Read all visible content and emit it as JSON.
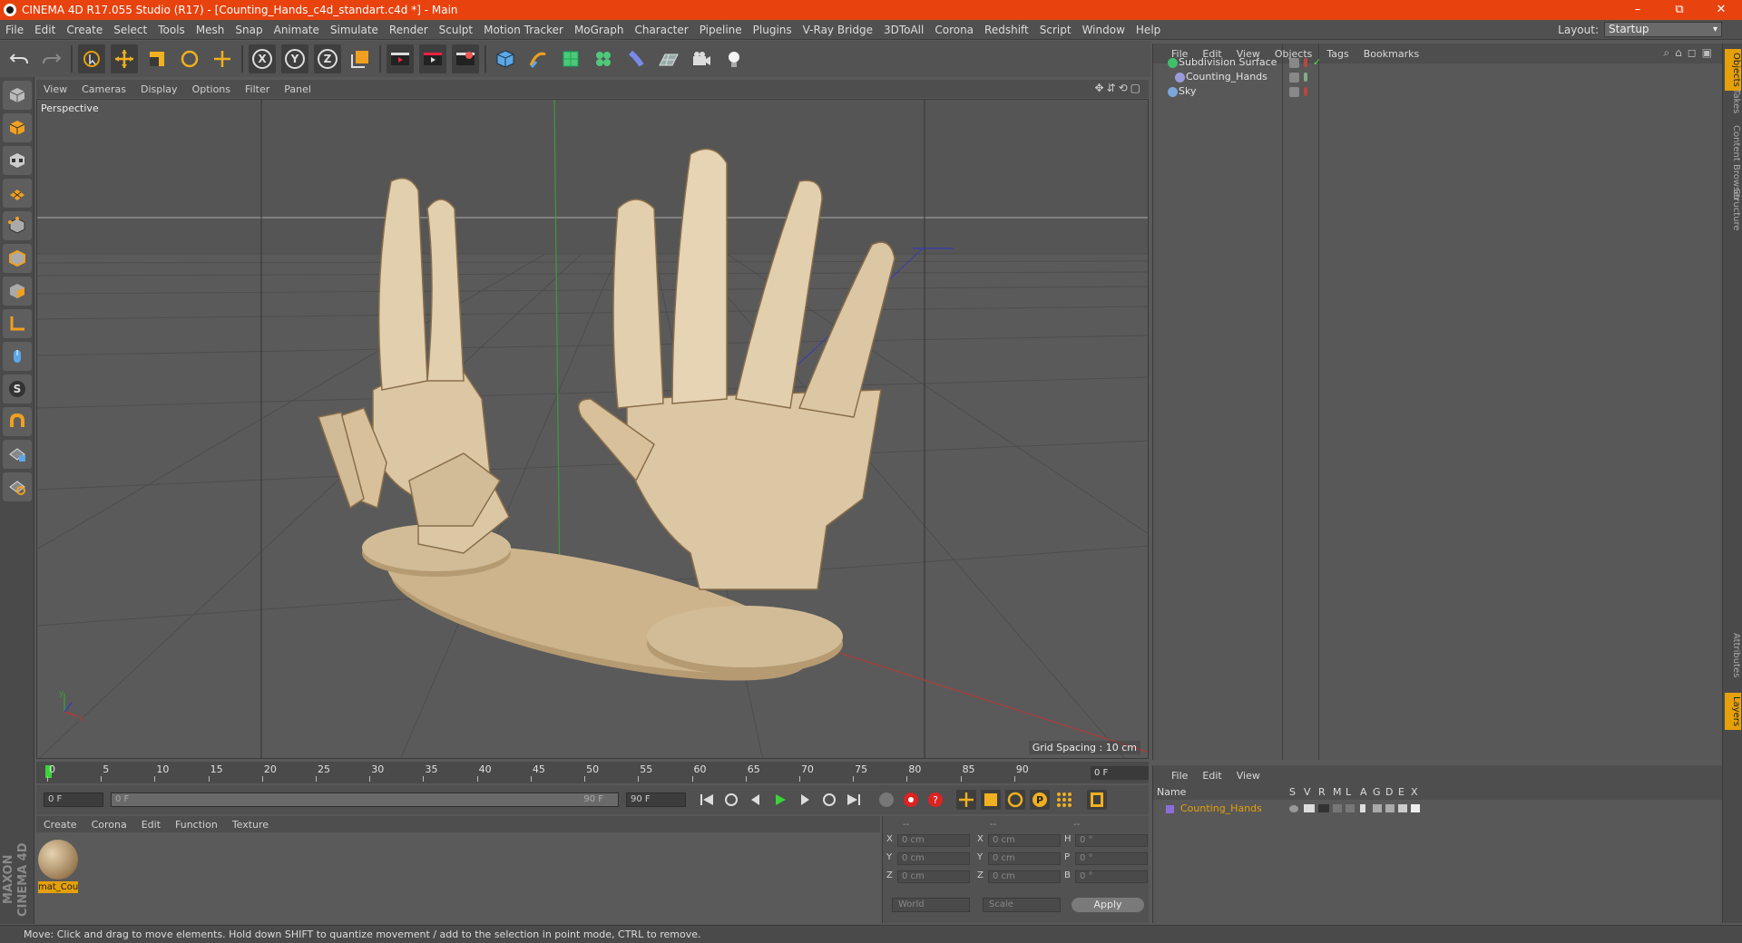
{
  "window": {
    "title": "CINEMA 4D R17.055 Studio (R17) - [Counting_Hands_c4d_standart.c4d *] - Main",
    "controls": [
      "–",
      "⧉",
      "✕"
    ]
  },
  "menubar": {
    "items": [
      "File",
      "Edit",
      "Create",
      "Select",
      "Tools",
      "Mesh",
      "Snap",
      "Animate",
      "Simulate",
      "Render",
      "Sculpt",
      "Motion Tracker",
      "MoGraph",
      "Character",
      "Pipeline",
      "Plugins",
      "V-Ray Bridge",
      "3DToAll",
      "Corona",
      "Redshift",
      "Script",
      "Window",
      "Help"
    ],
    "layout_label": "Layout:",
    "layout_value": "Startup"
  },
  "viewport": {
    "menu": [
      "View",
      "Cameras",
      "Display",
      "Options",
      "Filter",
      "Panel"
    ],
    "label": "Perspective",
    "grid_spacing": "Grid Spacing : 10 cm",
    "nav_icons": "✥⇵⟲▢",
    "axis_labels": {
      "y": "y",
      "x": "x"
    }
  },
  "timeline": {
    "ticks": [
      "0",
      "5",
      "10",
      "15",
      "20",
      "25",
      "30",
      "35",
      "40",
      "45",
      "50",
      "55",
      "60",
      "65",
      "70",
      "75",
      "80",
      "85",
      "90"
    ],
    "current_frame": "0 F",
    "start": "0 F",
    "range_start": "0 F",
    "range_end": "90 F",
    "end": "90 F"
  },
  "material_manager": {
    "menu": [
      "Create",
      "Corona",
      "Edit",
      "Function",
      "Texture"
    ],
    "materials": [
      {
        "name": "mat_Cou"
      }
    ]
  },
  "coordinates": {
    "header": [
      "--",
      "--",
      "--"
    ],
    "rows": [
      {
        "a": "X",
        "av": "0 cm",
        "b": "X",
        "bv": "0 cm",
        "c": "H",
        "cv": "0 °"
      },
      {
        "a": "Y",
        "av": "0 cm",
        "b": "Y",
        "bv": "0 cm",
        "c": "P",
        "cv": "0 °"
      },
      {
        "a": "Z",
        "av": "0 cm",
        "b": "Z",
        "bv": "0 cm",
        "c": "B",
        "cv": "0 °"
      }
    ],
    "mode": "World",
    "scale": "Scale",
    "apply": "Apply"
  },
  "object_manager": {
    "menu": [
      "File",
      "Edit",
      "View",
      "Objects",
      "Tags",
      "Bookmarks"
    ],
    "objects": [
      {
        "name": "Subdivision Surface",
        "color": "#3fbf6a"
      },
      {
        "name": "Counting_Hands",
        "color": "#9a9ad8"
      },
      {
        "name": "Sky",
        "color": "#7aa6d8"
      }
    ]
  },
  "layer_manager": {
    "menu": [
      "File",
      "Edit",
      "View"
    ],
    "columns": [
      "Name",
      "S",
      "V",
      "R",
      "M",
      "L",
      "A",
      "G",
      "D",
      "E",
      "X"
    ],
    "layers": [
      {
        "name": "Counting_Hands",
        "color": "#8a6dd8"
      }
    ]
  },
  "right_tabs": [
    "Objects",
    "Takes",
    "Content Browser",
    "Structure",
    "Attributes",
    "Layers"
  ],
  "status": "Move: Click and drag to move elements. Hold down SHIFT to quantize movement / add to the selection in point mode, CTRL to remove.",
  "branding": "MAXON CINEMA 4D",
  "colors": {
    "accent": "#e8420e",
    "selection": "#e5a00a",
    "hand": "#d9c4a0"
  }
}
